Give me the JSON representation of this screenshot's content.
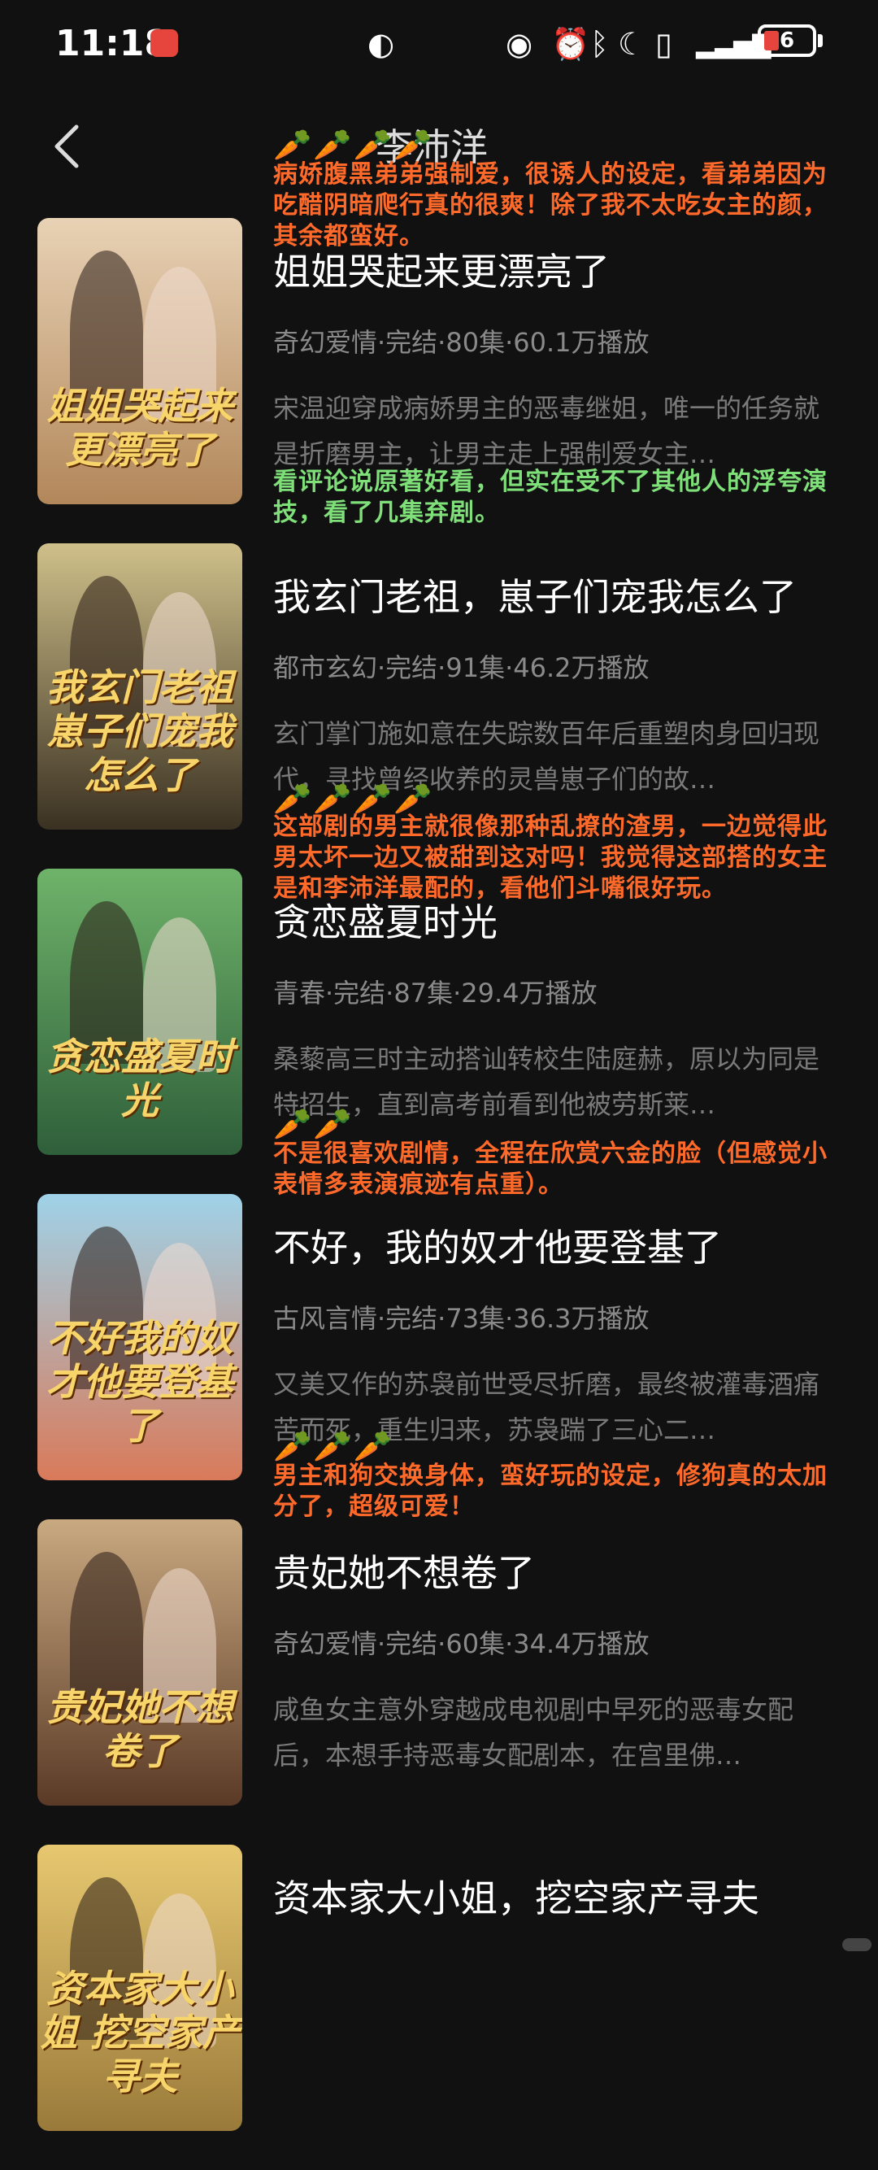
{
  "status_bar": {
    "time": "11:18",
    "battery": "6"
  },
  "header": {
    "title": "李沛洋"
  },
  "items": [
    {
      "title": "姐姐哭起来更漂亮了",
      "meta": "奇幻爱情·完结·80集·60.1万播放",
      "desc": "宋温迎穿成病娇男主的恶毒继姐，唯一的任务就是折磨男主，让男主走上强制爱女主…",
      "poster_text": "姐姐哭起来更漂亮了",
      "poster_colors": [
        "#e8d2b5",
        "#b2875a"
      ],
      "note": "病娇腹黑弟弟强制爱，很诱人的设定，看弟弟因为吃醋阴暗爬行真的很爽！除了我不太吃女主的颜，其余都蛮好。",
      "note_color": "orange",
      "carrots": "🥕🥕🥕🥕"
    },
    {
      "title": "我玄门老祖，崽子们宠我怎么了",
      "meta": "都市玄幻·完结·91集·46.2万播放",
      "desc": "玄门掌门施如意在失踪数百年后重塑肉身回归现代，寻找曾经收养的灵兽崽子们的故…",
      "poster_text": "我玄门老祖 崽子们宠我怎么了",
      "poster_colors": [
        "#cfc08a",
        "#3a3122"
      ],
      "note": "看评论说原著好看，但实在受不了其他人的浮夸演技，看了几集弃剧。",
      "note_color": "green",
      "carrots": ""
    },
    {
      "title": "贪恋盛夏时光",
      "meta": "青春·完结·87集·29.4万播放",
      "desc": "桑藜高三时主动搭讪转校生陆庭赫，原以为同是特招生，直到高考前看到他被劳斯莱…",
      "poster_text": "贪恋盛夏时光",
      "poster_colors": [
        "#6fb36a",
        "#2f5f3a"
      ],
      "note": "这部剧的男主就很像那种乱撩的渣男，一边觉得此男太坏一边又被甜到这对吗！我觉得这部搭的女主是和李沛洋最配的，看他们斗嘴很好玩。",
      "note_color": "orange",
      "carrots": "🥕🥕🥕🥕"
    },
    {
      "title": "不好，我的奴才他要登基了",
      "meta": "古风言情·完结·73集·36.3万播放",
      "desc": "又美又作的苏袅前世受尽折磨，最终被灌毒酒痛苦而死，重生归来，苏袅踹了三心二…",
      "poster_text": "不好我的奴才他要登基了",
      "poster_colors": [
        "#9fd2e8",
        "#d97a5a"
      ],
      "note": "不是很喜欢剧情，全程在欣赏六金的脸（但感觉小表情多表演痕迹有点重）。",
      "note_color": "orange",
      "carrots": "🥕🥕"
    },
    {
      "title": "贵妃她不想卷了",
      "meta": "奇幻爱情·完结·60集·34.4万播放",
      "desc": "咸鱼女主意外穿越成电视剧中早死的恶毒女配后，本想手持恶毒女配剧本，在宫里佛…",
      "poster_text": "贵妃她不想卷了",
      "poster_colors": [
        "#c9a980",
        "#5a3a26"
      ],
      "note": "男主和狗交换身体，蛮好玩的设定，修狗真的太加分了，超级可爱！",
      "note_color": "orange",
      "carrots": "🥕🥕🥕"
    },
    {
      "title": "资本家大小姐，挖空家产寻夫",
      "meta": "",
      "desc": "",
      "poster_text": "资本家大小姐 挖空家产寻夫",
      "poster_colors": [
        "#e7c870",
        "#9a7a3a"
      ],
      "note": "",
      "note_color": "orange",
      "carrots": ""
    }
  ]
}
